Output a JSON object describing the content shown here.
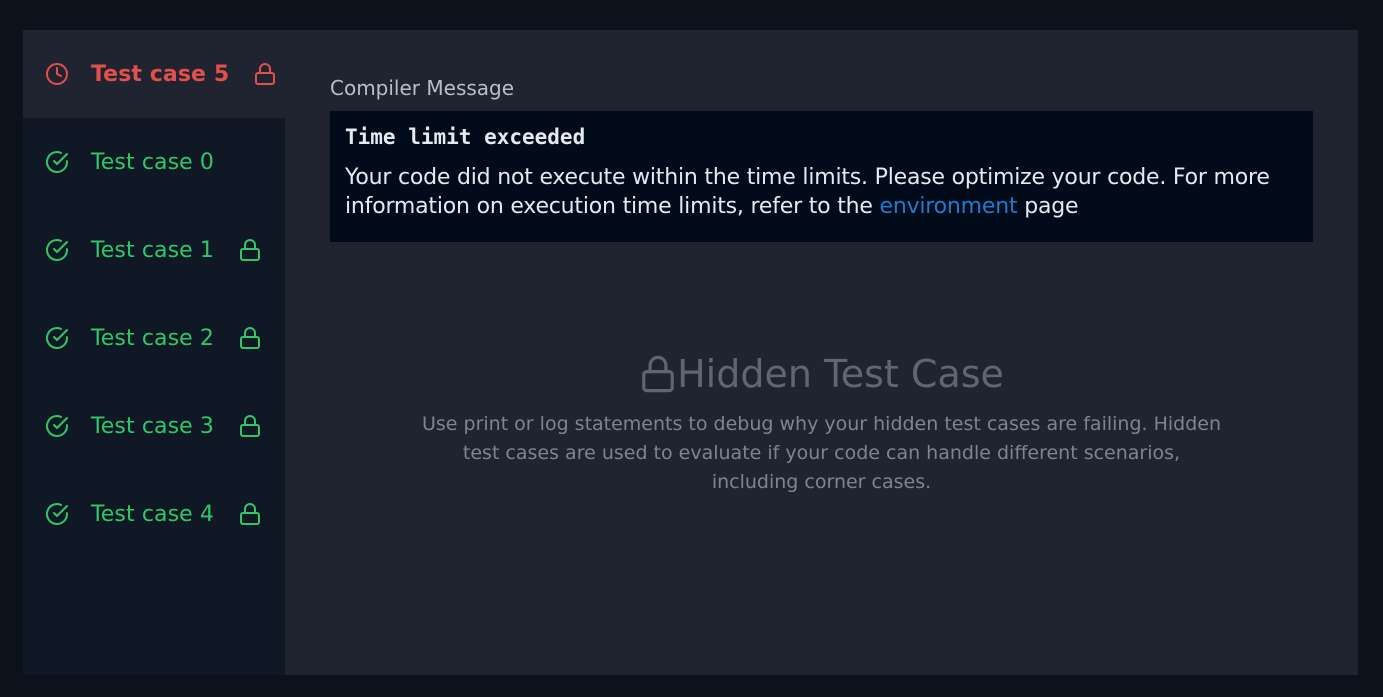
{
  "sidebar": {
    "cases": [
      {
        "label": "Test case 5",
        "status": "failed",
        "status_icon": "clock-icon",
        "locked": true,
        "active": true
      },
      {
        "label": "Test case 0",
        "status": "passed",
        "status_icon": "check-circle-icon",
        "locked": false,
        "active": false
      },
      {
        "label": "Test case 1",
        "status": "passed",
        "status_icon": "check-circle-icon",
        "locked": true,
        "active": false
      },
      {
        "label": "Test case 2",
        "status": "passed",
        "status_icon": "check-circle-icon",
        "locked": true,
        "active": false
      },
      {
        "label": "Test case 3",
        "status": "passed",
        "status_icon": "check-circle-icon",
        "locked": true,
        "active": false
      },
      {
        "label": "Test case 4",
        "status": "passed",
        "status_icon": "check-circle-icon",
        "locked": true,
        "active": false
      }
    ]
  },
  "compiler": {
    "label": "Compiler Message",
    "title": "Time limit exceeded",
    "message_before": "Your code did not execute within the time limits. Please optimize your code. For more information on execution time limits, refer to the ",
    "link_text": "environment",
    "message_after": " page"
  },
  "hidden": {
    "title": "Hidden Test Case",
    "description": "Use print or log statements to debug why your hidden test cases are failing. Hidden test cases are used to evaluate if your code can handle different scenarios, including corner cases."
  },
  "colors": {
    "pass": "#2ec866",
    "fail": "#e2504c",
    "link": "#1f7ad1"
  }
}
